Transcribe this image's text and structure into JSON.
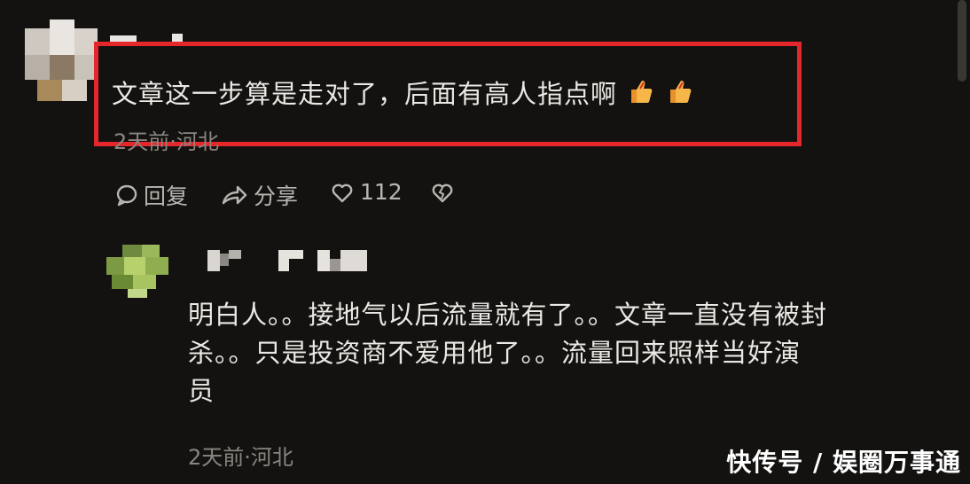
{
  "comment1": {
    "text": "文章这一步算是走对了，后面有高人指点啊",
    "emoji": [
      "thumbs-up-icon",
      "thumbs-up-icon"
    ],
    "meta": "2天前·河北",
    "actions": {
      "reply": "回复",
      "share": "分享",
      "likes": "112"
    }
  },
  "reply1": {
    "text_line1": "明白人。。接地气以后流量就有了。。文章一直没有被封",
    "text_line2": "杀。。只是投资商不爱用他了。。流量回来照样当好演",
    "text_line3": "员",
    "meta": "2天前·河北"
  },
  "watermark": "快传号 / 娱圈万事通",
  "colors": {
    "highlight": "#e5262b",
    "background": "#141210",
    "text": "#ece9e4",
    "meta": "#8a8580"
  }
}
